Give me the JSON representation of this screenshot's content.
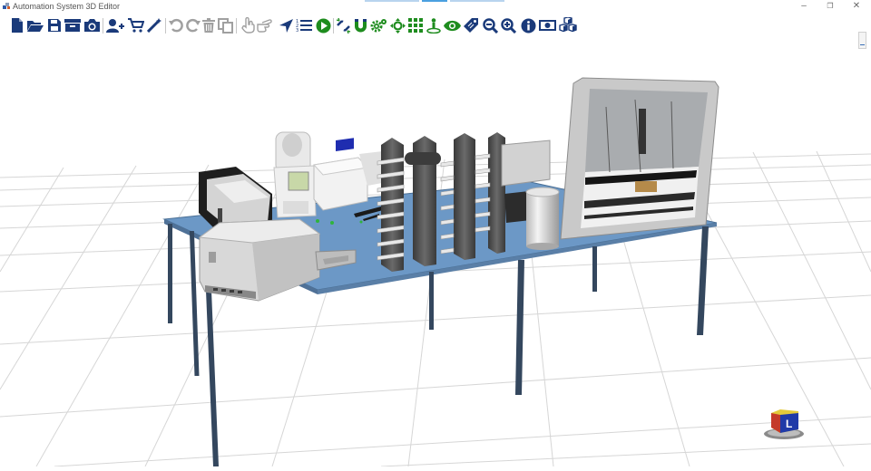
{
  "app": {
    "title": "Automation System 3D Editor",
    "accent_color": "#4ba0e0"
  },
  "window_controls": [
    {
      "name": "minimize",
      "glyph": "–"
    },
    {
      "name": "restore",
      "glyph": "❐"
    },
    {
      "name": "close",
      "glyph": "✕"
    }
  ],
  "toolbar": {
    "groups": [
      [
        "new-file-icon",
        "open-folder-icon",
        "save-icon",
        "archive-icon",
        "camera-icon"
      ],
      [
        "add-user-icon",
        "shopping-cart-icon",
        "magic-wand-icon"
      ],
      [
        "undo-icon",
        "redo-icon",
        "trash-icon",
        "copy-icon"
      ],
      [
        "hand-pointer-icon",
        "hand-point-right-icon",
        "location-arrow-icon",
        "list-icon",
        "play-circle-icon"
      ],
      [
        "unlink-icon",
        "magnet-icon",
        "cogs-icon",
        "crosshairs-icon",
        "grid-icon",
        "anchor-person-icon",
        "eye-icon",
        "tag-icon",
        "zoom-out-icon",
        "zoom-in-icon",
        "info-icon",
        "money-icon",
        "cubes-icon"
      ]
    ],
    "colors": {
      "dark": "#1a3a7a",
      "gray": "#a0a0a0",
      "green": "#1e8c1e"
    }
  },
  "viewport": {
    "scene": "3d-workcell",
    "table_color": "#6c98c6",
    "leg_color": "#34475e",
    "grid_color": "#d6d6d6",
    "orientation_cube_label": "L"
  }
}
